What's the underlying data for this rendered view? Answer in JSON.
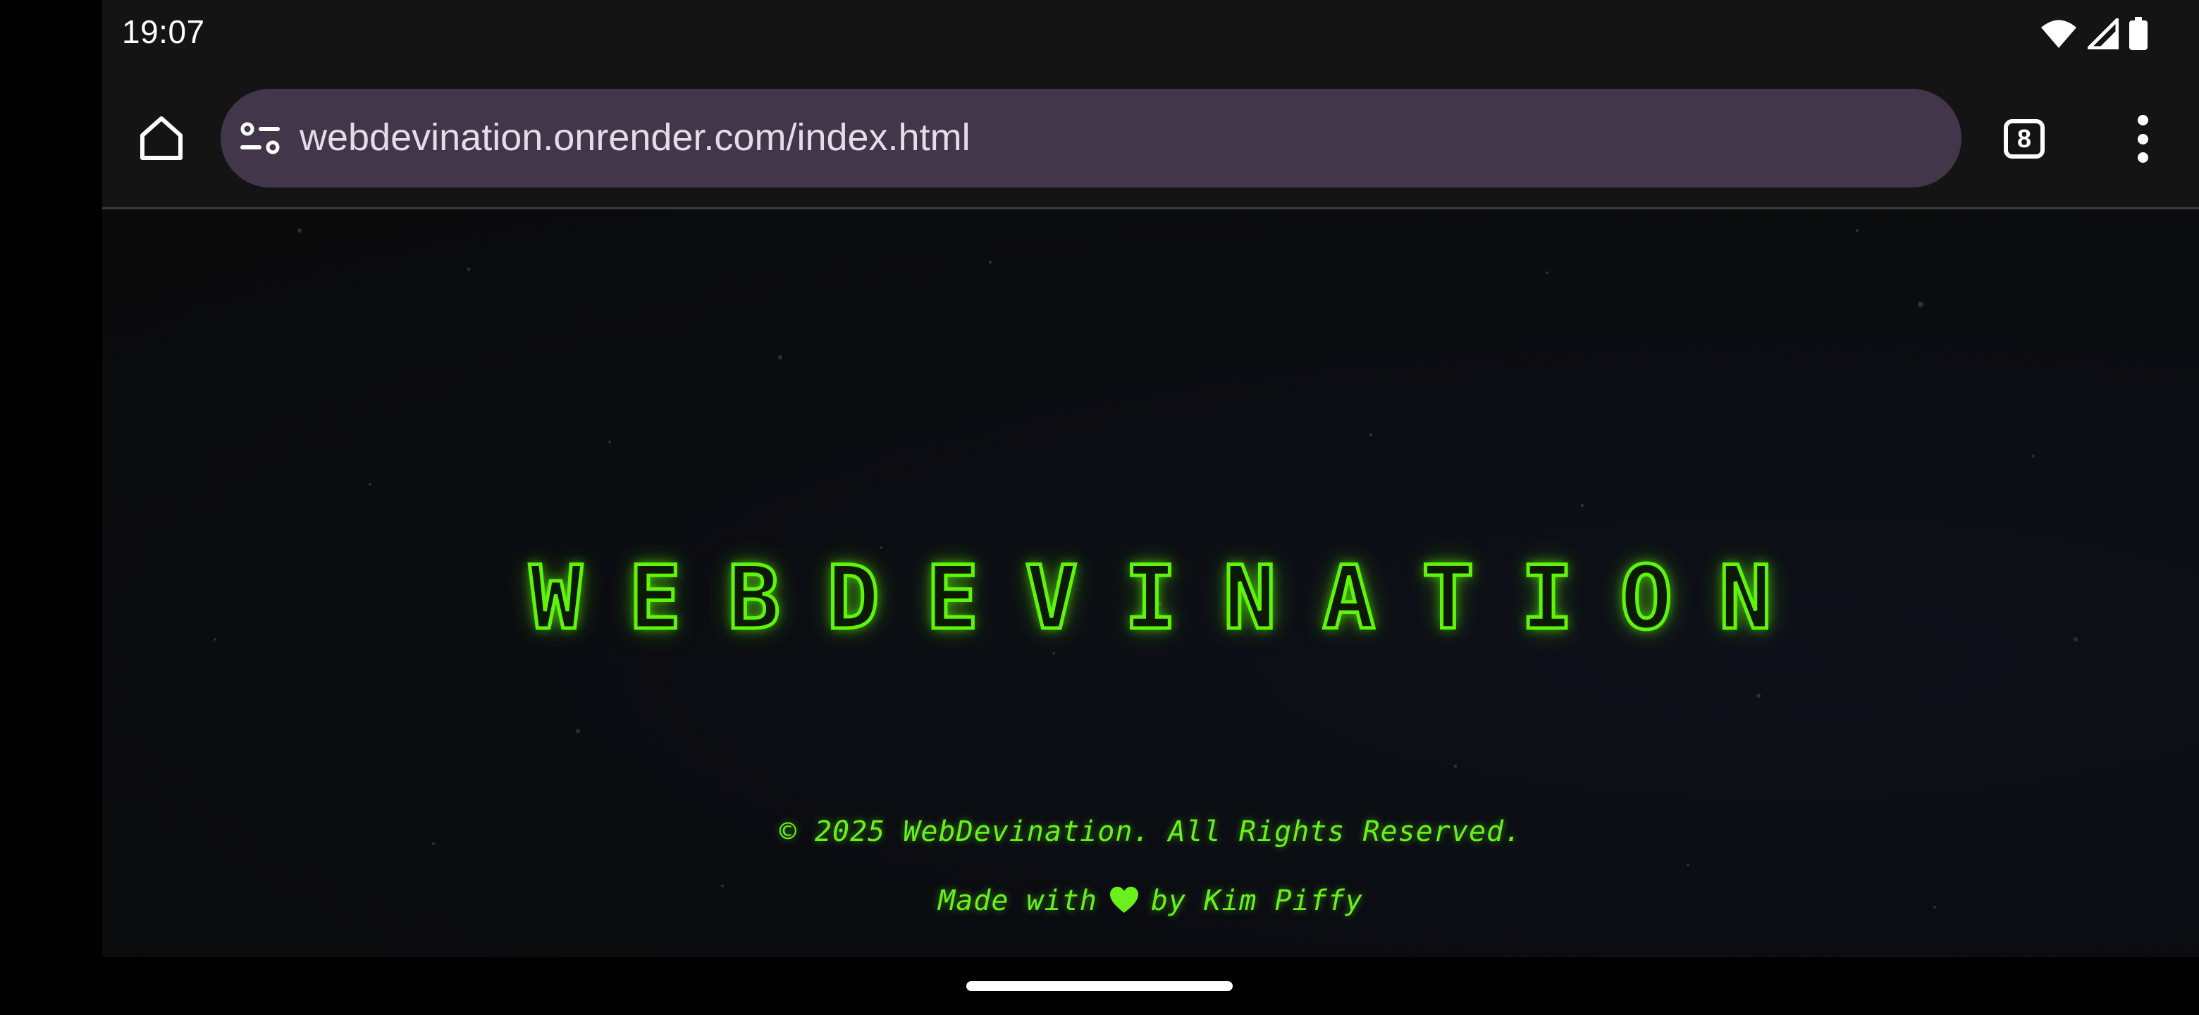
{
  "status_bar": {
    "time": "19:07",
    "icons": [
      "wifi-icon",
      "cell-signal-icon",
      "battery-icon"
    ]
  },
  "browser": {
    "url": "webdevination.onrender.com/index.html",
    "tab_count": "8",
    "icons": [
      "home-icon",
      "site-settings-icon",
      "tab-switcher-icon",
      "more-vert-icon"
    ]
  },
  "page": {
    "logo_text": "WEBDEVINATION",
    "copyright": "© 2025 WebDevination. All Rights Reserved.",
    "made_with_prefix": "Made with",
    "made_with_suffix": "by Kim Piffy"
  },
  "colors": {
    "accent_green": "#5ef50b",
    "url_bar_bg": "#42364a",
    "page_bg": "#0b0c10"
  }
}
